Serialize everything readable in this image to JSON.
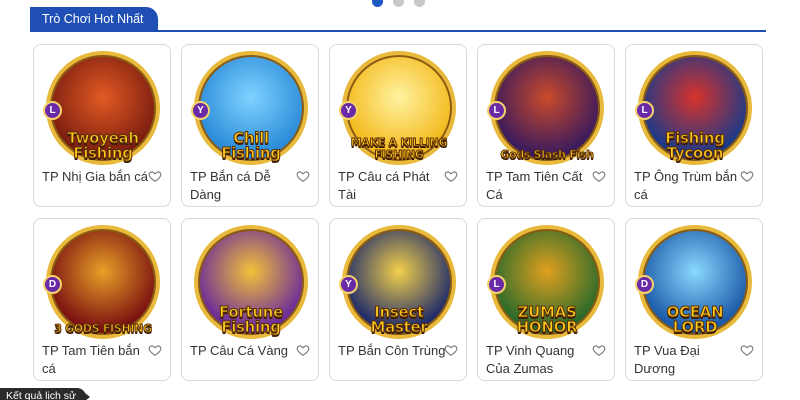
{
  "pager": {
    "dots": 3,
    "active_index": 0
  },
  "section": {
    "title": "Trò Chơi Hot Nhất"
  },
  "games": [
    {
      "label": "TP Nhị Gia bắn cá",
      "badge": "L",
      "logo_line1": "Twoyeah",
      "logo_line2": "Fishing",
      "bg": "#7a1d10",
      "glow": "#e25a22"
    },
    {
      "label": "TP Bắn cá Dễ Dàng",
      "badge": "Y",
      "logo_line1": "Chill",
      "logo_line2": "Fishing",
      "bg": "#2a8ad8",
      "glow": "#7fd3ff"
    },
    {
      "label": "TP Câu cá Phát Tài",
      "badge": "Y",
      "logo_line1": "MAKE A KILLING",
      "logo_line2": "FISHING",
      "bg": "#f3b81a",
      "glow": "#fff3a0"
    },
    {
      "label": "TP Tam Tiên Cất Cá",
      "badge": "L",
      "logo_line1": "Gods Slash Fish",
      "logo_line2": "",
      "bg": "#3a1a5e",
      "glow": "#c94a2a"
    },
    {
      "label": "TP Ông Trùm bắn cá",
      "badge": "L",
      "logo_line1": "Fishing",
      "logo_line2": "Tycoon",
      "bg": "#1a3a8a",
      "glow": "#d8322a"
    },
    {
      "label": "TP Tam Tiên bắn cá",
      "badge": "D",
      "logo_line1": "3 GODS FISHING",
      "logo_line2": "",
      "bg": "#7a1010",
      "glow": "#e8a028"
    },
    {
      "label": "TP Câu Cá Vàng",
      "badge": "",
      "logo_line1": "Fortune",
      "logo_line2": "Fishing",
      "bg": "#6a2a9a",
      "glow": "#f2c23a"
    },
    {
      "label": "TP Bắn Côn Trùng",
      "badge": "Y",
      "logo_line1": "Insect",
      "logo_line2": "Master",
      "bg": "#1e2a6a",
      "glow": "#f2d04a"
    },
    {
      "label": "TP Vinh Quang Của Zumas",
      "badge": "L",
      "logo_line1": "ZUMAS",
      "logo_line2": "HONOR",
      "bg": "#2a6a2a",
      "glow": "#e0a020"
    },
    {
      "label": "TP Vua Đại Dương",
      "badge": "D",
      "logo_line1": "OCEAN",
      "logo_line2": "LORD",
      "bg": "#1a5aa8",
      "glow": "#8ad8ff"
    }
  ],
  "tooltip": {
    "text": "Kết quả lịch sử"
  },
  "colors": {
    "accent": "#1f4fb5",
    "dot_inactive": "#c8c8c8",
    "card_border": "#d9d9d9",
    "text": "#333333"
  },
  "icons": {
    "favorite": "heart-outline-icon"
  }
}
